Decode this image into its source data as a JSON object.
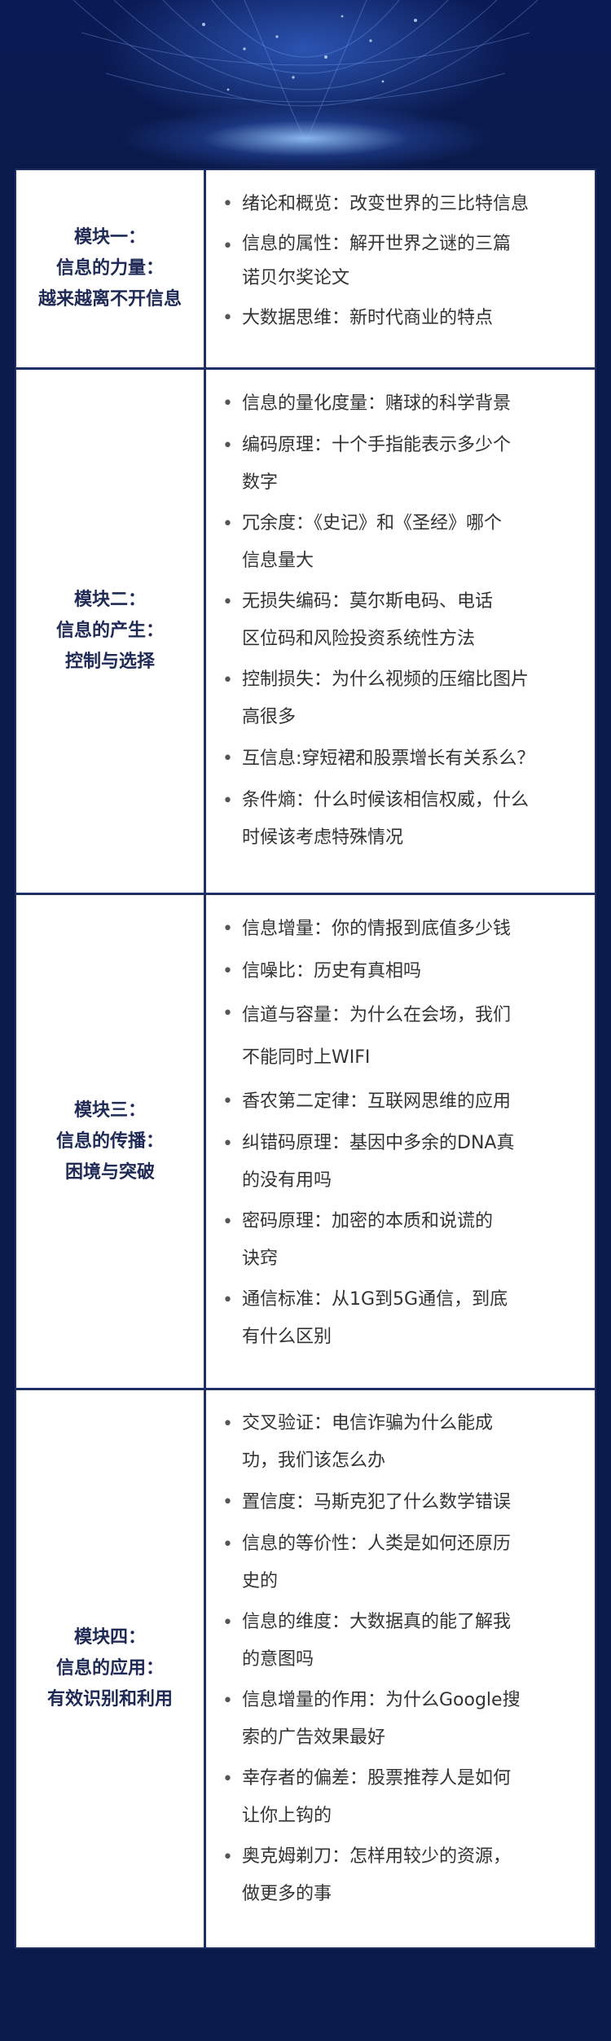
{
  "modules": [
    {
      "title_lines": [
        "模块一：",
        "信息的力量：",
        "越来越离不开信息"
      ],
      "items": [
        {
          "lines": [
            "绪论和概览：改变世界的三比特信息"
          ]
        },
        {
          "lines": [
            "信息的属性：解开世界之谜的三篇",
            "诺贝尔奖论文"
          ]
        },
        {
          "lines": [
            "大数据思维：新时代商业的特点"
          ]
        }
      ]
    },
    {
      "title_lines": [
        "模块二：",
        "信息的产生：",
        "控制与选择"
      ],
      "items": [
        {
          "lines": [
            "信息的量化度量：赌球的科学背景"
          ]
        },
        {
          "lines": [
            "编码原理：十个手指能表示多少个",
            "数字"
          ]
        },
        {
          "lines": [
            "冗余度：《史记》和《圣经》哪个",
            "信息量大"
          ]
        },
        {
          "lines": [
            "无损失编码：莫尔斯电码、电话",
            "区位码和风险投资系统性方法"
          ]
        },
        {
          "lines": [
            "控制损失：为什么视频的压缩比图片",
            "高很多"
          ]
        },
        {
          "lines": [
            "互信息:穿短裙和股票增长有关系么？"
          ]
        },
        {
          "lines": [
            "条件熵：什么时候该相信权威，什么",
            "时候该考虑特殊情况"
          ]
        }
      ]
    },
    {
      "title_lines": [
        "模块三：",
        "信息的传播：",
        "困境与突破"
      ],
      "items": [
        {
          "lines": [
            "信息增量：你的情报到底值多少钱"
          ]
        },
        {
          "lines": [
            "信噪比：历史有真相吗"
          ]
        },
        {
          "lines": [
            "信道与容量：为什么在会场，我们",
            "不能同时上WIFI"
          ]
        },
        {
          "lines": [
            "香农第二定律：互联网思维的应用"
          ]
        },
        {
          "lines": [
            "纠错码原理：基因中多余的DNA真",
            "的没有用吗"
          ]
        },
        {
          "lines": [
            "密码原理：加密的本质和说谎的",
            "诀窍"
          ]
        },
        {
          "lines": [
            "通信标准：从1G到5G通信，到底",
            "有什么区别"
          ]
        }
      ]
    },
    {
      "title_lines": [
        "模块四：",
        "信息的应用：",
        "有效识别和利用"
      ],
      "items": [
        {
          "lines": [
            "交叉验证：电信诈骗为什么能成",
            "功，我们该怎么办"
          ]
        },
        {
          "lines": [
            "置信度：马斯克犯了什么数学错误"
          ]
        },
        {
          "lines": [
            "信息的等价性：人类是如何还原历",
            "史的"
          ]
        },
        {
          "lines": [
            "信息的维度：大数据真的能了解我",
            "的意图吗"
          ]
        },
        {
          "lines": [
            "信息增量的作用：为什么Google搜",
            "索的广告效果最好"
          ]
        },
        {
          "lines": [
            "幸存者的偏差：股票推荐人是如何",
            "让你上钩的"
          ]
        },
        {
          "lines": [
            "奥克姆剃刀：怎样用较少的资源，",
            "做更多的事"
          ]
        }
      ]
    }
  ],
  "bullet_glyph": "•",
  "colors": {
    "background": "#0a1a4a",
    "border": "#1e2f66",
    "title_text": "#1e2a55",
    "body_text": "#333333",
    "glow": "#96c8ff"
  }
}
